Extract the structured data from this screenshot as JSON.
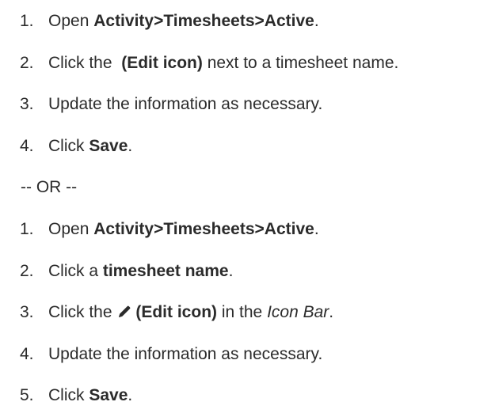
{
  "procedure_a": [
    {
      "num": "1.",
      "pre": "Open ",
      "bold": "Activity>Timesheets>Active",
      "post": "."
    },
    {
      "num": "2.",
      "pre": "Click the  ",
      "bold": "(Edit icon)",
      "post": " next to a timesheet name."
    },
    {
      "num": "3.",
      "text": "Update the information as necessary."
    },
    {
      "num": "4.",
      "pre": "Click ",
      "bold": "Save",
      "post": "."
    }
  ],
  "separator": "-- OR --",
  "procedure_b": [
    {
      "num": "1.",
      "pre": "Open ",
      "bold": "Activity>Timesheets>Active",
      "post": "."
    },
    {
      "num": "2.",
      "pre": "Click a ",
      "bold": "timesheet name",
      "post": "."
    },
    {
      "num": "3.",
      "pre": "Click the ",
      "icon": "pencil-icon",
      "bold": "(Edit icon)",
      "post_pre": " in the ",
      "italic": "Icon Bar",
      "post": "."
    },
    {
      "num": "4.",
      "text": "Update the information as necessary."
    },
    {
      "num": "5.",
      "pre": "Click ",
      "bold": "Save",
      "post": "."
    }
  ],
  "colors": {
    "text": "#2b2b2b",
    "background": "#ffffff"
  }
}
